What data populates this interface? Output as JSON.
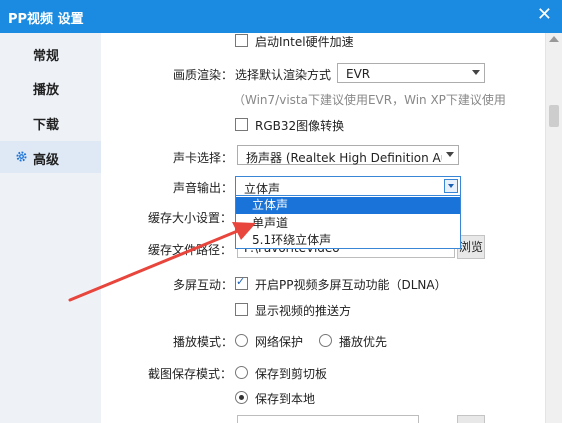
{
  "window": {
    "title": "PP视频 设置"
  },
  "sidebar": {
    "items": [
      {
        "label": "常规",
        "active": false
      },
      {
        "label": "播放",
        "active": false
      },
      {
        "label": "下载",
        "active": false
      },
      {
        "label": "高级",
        "active": true,
        "icon": "gear-icon"
      }
    ]
  },
  "settings": {
    "intel_hw_accel": {
      "label": "启动Intel硬件加速",
      "checked": false
    },
    "render": {
      "label": "画质渲染：",
      "sublabel": "选择默认渲染方式",
      "value": "EVR",
      "hint": "（Win7/vista下建议使用EVR，Win XP下建议使用"
    },
    "rgb32": {
      "label": "RGB32图像转换",
      "checked": false
    },
    "sound_card": {
      "label": "声卡选择：",
      "value": "扬声器 (Realtek High Definition Au"
    },
    "sound_output": {
      "label": "声音输出：",
      "value": "立体声",
      "options": [
        "立体声",
        "单声道",
        "5.1环绕立体声"
      ],
      "highlighted_index": 0
    },
    "cache_size": {
      "label": "缓存大小设置："
    },
    "cache_path": {
      "label": "缓存文件路径：",
      "value": "F:\\FavoriteVideo",
      "browse_label": "浏览"
    },
    "multiscreen": {
      "label": "多屏互动：",
      "dlna": {
        "label": "开启PP视频多屏互动功能（DLNA）",
        "checked": true
      },
      "push": {
        "label": "显示视频的推送方",
        "checked": false
      }
    },
    "playback_mode": {
      "label": "播放模式：",
      "options": [
        {
          "label": "网络保护",
          "checked": false
        },
        {
          "label": "播放优先",
          "checked": false
        }
      ]
    },
    "screenshot_mode": {
      "label": "截图保存模式：",
      "options": [
        {
          "label": "保存到剪切板",
          "checked": false
        },
        {
          "label": "保存到本地",
          "checked": true
        }
      ]
    }
  },
  "colors": {
    "titlebar": "#1a8be0",
    "selection": "#1a73d9",
    "annotation_arrow": "#e8453c"
  }
}
